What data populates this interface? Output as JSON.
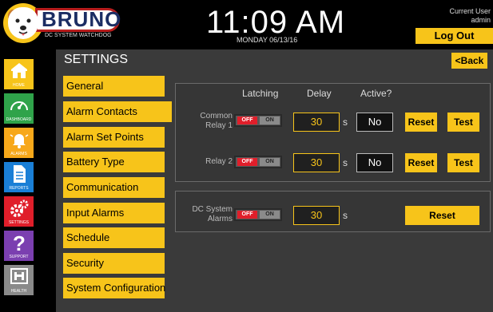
{
  "brand": {
    "name": "BRUNO",
    "tagline": "DC SYSTEM WATCHDOG"
  },
  "clock": {
    "time": "11:09 AM",
    "date": "MONDAY 06/13/16"
  },
  "user": {
    "line1": "Current User",
    "line2": "admin",
    "logout_label": "Log Out"
  },
  "page": {
    "title": "SETTINGS",
    "back_label": "<Back"
  },
  "sidebar": {
    "items": [
      {
        "label": "HOME",
        "icon": "home-icon",
        "color": "#f7c41a"
      },
      {
        "label": "DASHBOARD",
        "icon": "gauge-icon",
        "color": "#2fa34a"
      },
      {
        "label": "ALARMS",
        "icon": "bell-icon",
        "color": "#f7a81a"
      },
      {
        "label": "REPORTS",
        "icon": "document-icon",
        "color": "#1a7fd6"
      },
      {
        "label": "SETTINGS",
        "icon": "gears-icon",
        "color": "#e01e2a"
      },
      {
        "label": "SUPPORT",
        "icon": "question-icon",
        "color": "#7b3fb0"
      },
      {
        "label": "HEALTH",
        "icon": "health-icon",
        "color": "#8a8a8a"
      }
    ]
  },
  "menu": {
    "items": [
      {
        "label": "General"
      },
      {
        "label": "Alarm Contacts",
        "selected": true
      },
      {
        "label": "Alarm Set Points"
      },
      {
        "label": "Battery Type"
      },
      {
        "label": "Communication"
      },
      {
        "label": "Input Alarms"
      },
      {
        "label": "Schedule"
      },
      {
        "label": "Security"
      },
      {
        "label": "System Configuration"
      }
    ]
  },
  "relays": {
    "headers": {
      "latching": "Latching",
      "delay": "Delay",
      "active": "Active?"
    },
    "rows": [
      {
        "label_line1": "Common",
        "label_line2": "Relay 1",
        "toggle_off": "OFF",
        "toggle_on": "ON",
        "delay": "30",
        "unit": "s",
        "active": "No",
        "reset": "Reset",
        "test": "Test"
      },
      {
        "label_line1": "Relay 2",
        "label_line2": "",
        "toggle_off": "OFF",
        "toggle_on": "ON",
        "delay": "30",
        "unit": "s",
        "active": "No",
        "reset": "Reset",
        "test": "Test"
      }
    ]
  },
  "dc_alarms": {
    "label_line1": "DC System",
    "label_line2": "Alarms",
    "toggle_off": "OFF",
    "toggle_on": "ON",
    "delay": "30",
    "unit": "s",
    "reset": "Reset"
  },
  "colors": {
    "accent": "#f7c41a",
    "danger": "#e01e2a",
    "panel_bg": "#3a3a3a"
  }
}
